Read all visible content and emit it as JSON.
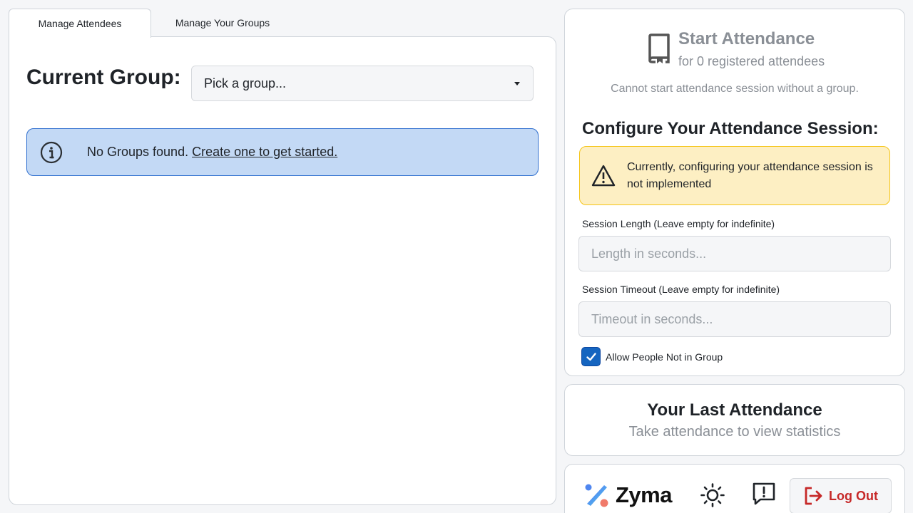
{
  "tabs": [
    {
      "label": "Manage Attendees",
      "active": true
    },
    {
      "label": "Manage Your Groups",
      "active": false
    }
  ],
  "left": {
    "current_group_label": "Current Group:",
    "group_select_value": "Pick a group...",
    "alert": {
      "icon": "info-icon",
      "message": "No Groups found.",
      "link": "Create one to get started."
    }
  },
  "start": {
    "icon": "book-icon",
    "title": "Start Attendance",
    "subtitle": "for 0 registered attendees",
    "note": "Cannot start attendance session without a group.",
    "config_title": "Configure Your Attendance Session:",
    "warning": {
      "icon": "warning-icon",
      "message": "Currently, configuring your attendance session is not implemented"
    },
    "session_length": {
      "label": "Session Length (Leave empty for indefinite)",
      "placeholder": "Length in seconds..."
    },
    "session_timeout": {
      "label": "Session Timeout (Leave empty for indefinite)",
      "placeholder": "Timeout in seconds..."
    },
    "allow_checkbox": {
      "label": "Allow People Not in Group",
      "checked": true
    }
  },
  "last_attendance": {
    "title": "Your Last Attendance",
    "subtitle": "Take attendance to view statistics"
  },
  "footer": {
    "logo_text": "Zyma",
    "theme_icon": "sun-icon",
    "feedback_icon": "feedback-icon",
    "logout_label": "Log Out",
    "logout_icon": "logout-icon"
  },
  "colors": {
    "info_bg": "#c3d9f5",
    "info_border": "#2f6fcf",
    "warn_bg": "#fdefc3",
    "warn_border": "#f5c518",
    "checkbox": "#1565c0",
    "logout": "#c62828"
  }
}
